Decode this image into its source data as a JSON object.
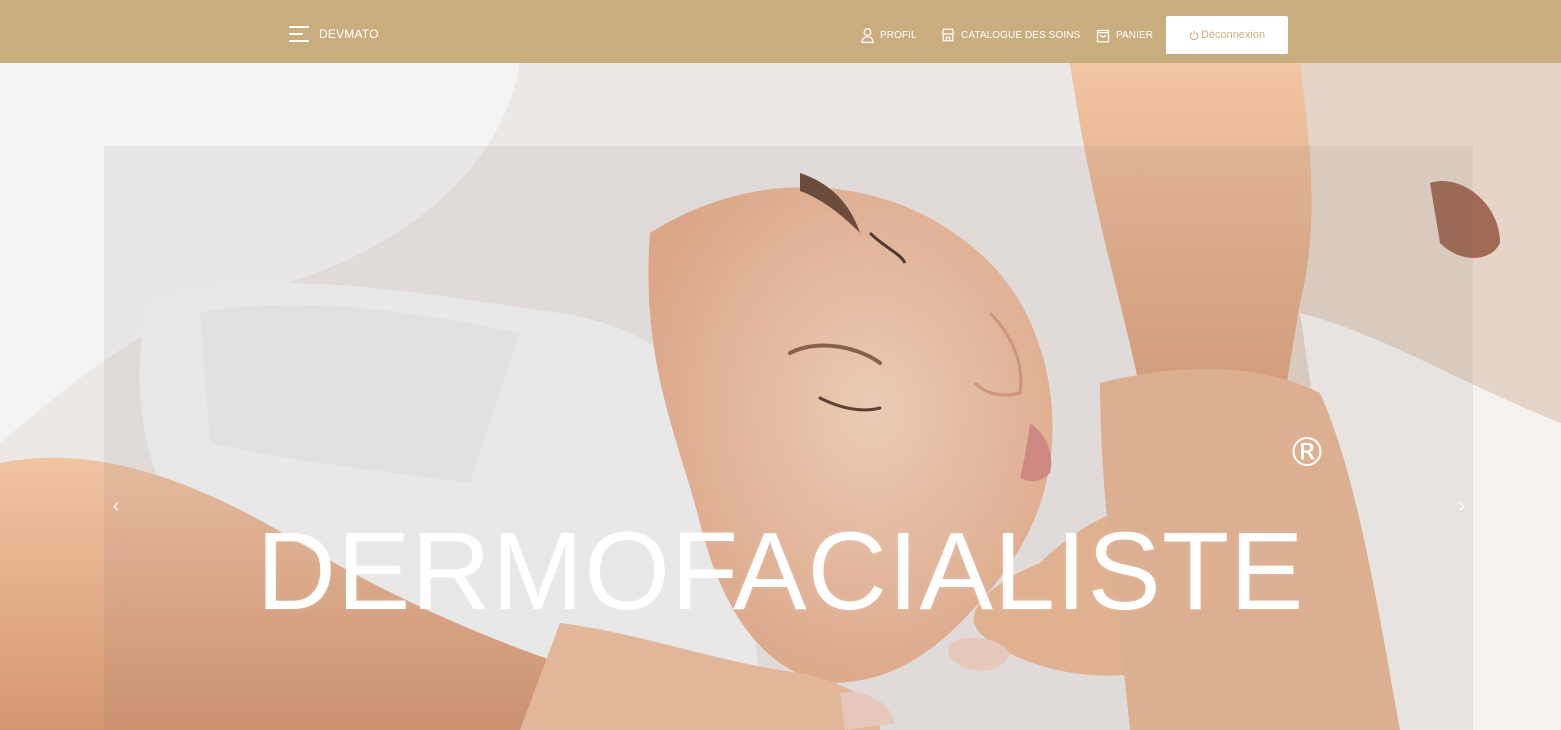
{
  "navbar": {
    "brand": "DEVMATO",
    "menu_icon": "hamburger-menu-icon",
    "items": [
      {
        "label": "PROFIL",
        "icon": "user-icon"
      },
      {
        "label": "CATALOGUE DES SOINS",
        "icon": "store-icon"
      },
      {
        "label": "PANIER",
        "icon": "shopping-bag-icon"
      }
    ],
    "logout": {
      "label": "Déconnexion",
      "icon": "power-icon"
    }
  },
  "hero": {
    "title": "DERMOFACIALISTE",
    "trademark": "®",
    "prev_icon": "chevron-left-icon",
    "next_icon": "chevron-right-icon",
    "prev_glyph": "‹",
    "next_glyph": "›"
  },
  "colors": {
    "navbar_bg": "#c9ad7f",
    "navbar_text": "#ffffff",
    "logout_bg": "#ffffff",
    "logout_text": "#c9ad7f"
  }
}
